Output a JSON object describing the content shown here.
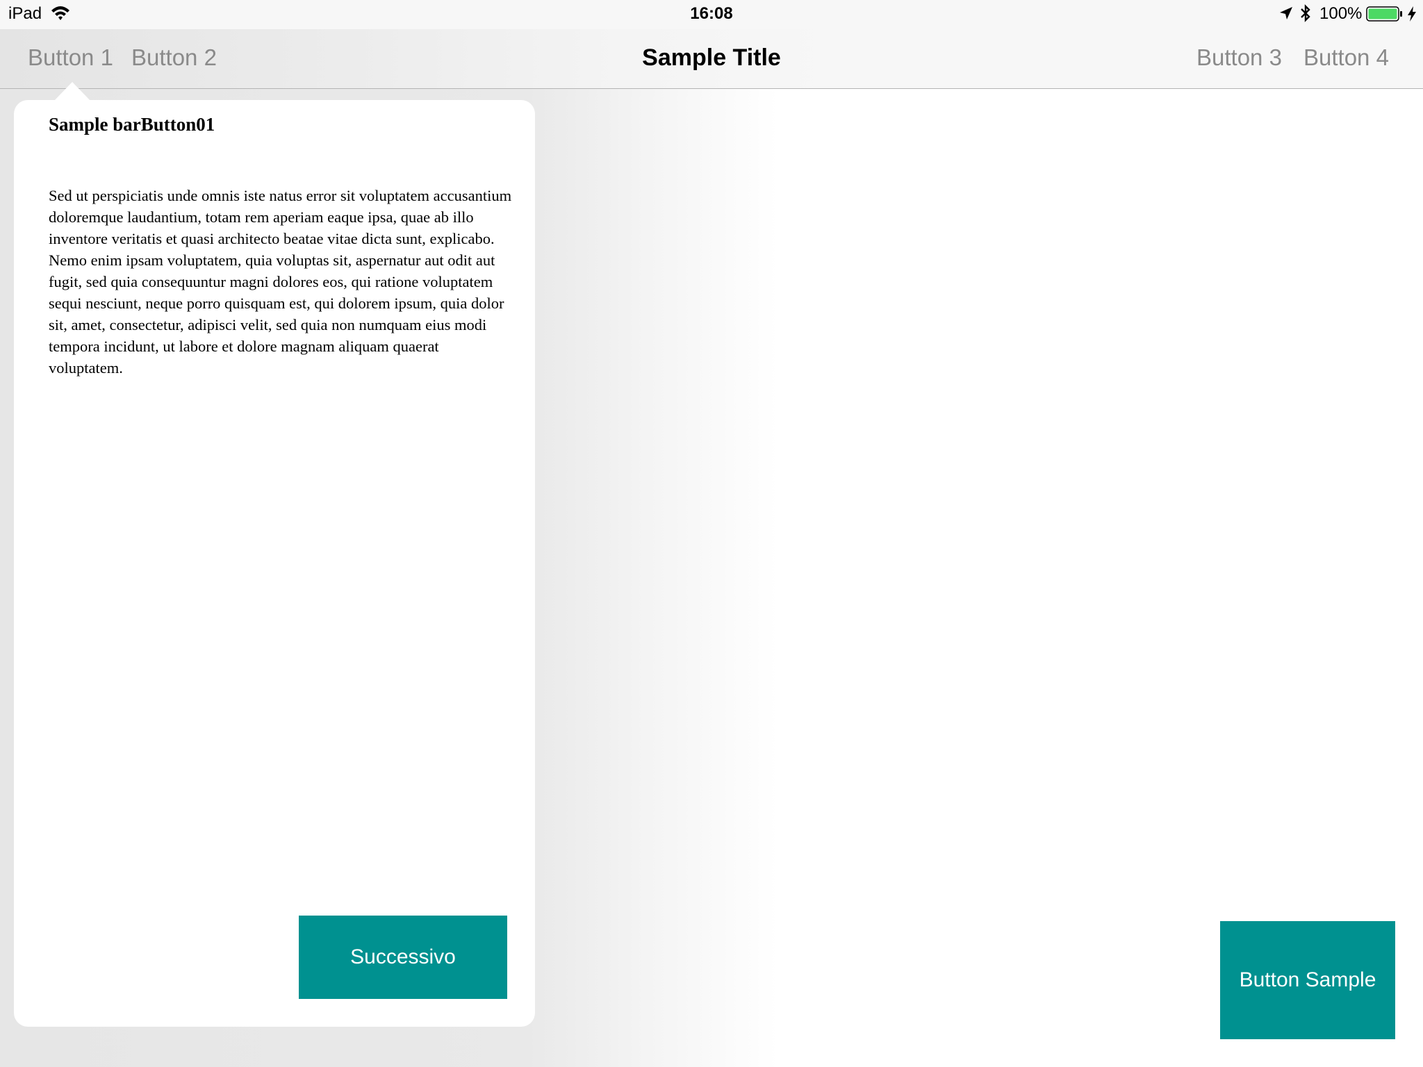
{
  "status_bar": {
    "device": "iPad",
    "time": "16:08",
    "battery": "100%",
    "icons": [
      "wifi-icon",
      "location-icon",
      "bluetooth-icon",
      "battery-icon",
      "charging-icon"
    ],
    "battery_color": "#4cd964"
  },
  "nav_bar": {
    "left_buttons": [
      "Button 1",
      "Button 2"
    ],
    "title": "Sample Title",
    "right_buttons": [
      "Button 3",
      "Button 4"
    ]
  },
  "popover": {
    "title": "Sample barButton01",
    "body": "Sed ut perspiciatis unde omnis iste natus error sit voluptatem accusantium doloremque laudantium, totam rem aperiam eaque ipsa, quae ab illo inventore veritatis et quasi architecto beatae vitae dicta sunt, explicabo. Nemo enim ipsam voluptatem, quia voluptas sit, aspernatur aut odit aut fugit, sed quia consequuntur magni dolores eos, qui ratione voluptatem sequi nesciunt, neque porro quisquam est, qui dolorem ipsum, quia dolor sit, amet, consectetur, adipisci velit, sed quia non numquam eius modi tempora incidunt, ut labore et dolore magnam aliquam quaerat voluptatem.",
    "next_button": "Successivo"
  },
  "main": {
    "sample_button": "Button Sample"
  },
  "colors": {
    "accent": "#009190",
    "bar_button_text": "#8a8a8a"
  }
}
